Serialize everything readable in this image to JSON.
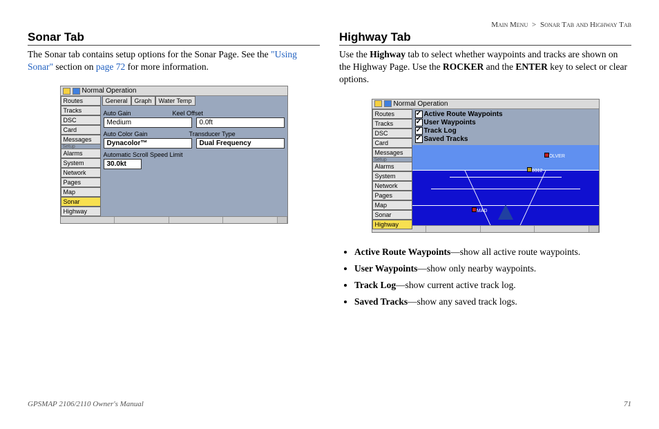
{
  "breadcrumb": {
    "root": "Main Menu",
    "sep": ">",
    "leaf": "Sonar Tab and Highway Tab"
  },
  "sonar": {
    "heading": "Sonar Tab",
    "intro_a": "The Sonar tab contains setup options for the Sonar Page. See the ",
    "intro_link": "\"Using Sonar\"",
    "intro_b": " section on ",
    "intro_page": "page 72",
    "intro_c": " for more information.",
    "app_title": "Normal Operation",
    "tabs": [
      "Routes",
      "Tracks",
      "DSC",
      "Card",
      "Messages"
    ],
    "spacer": "Setup",
    "tabs2": [
      "Alarms",
      "System",
      "Network",
      "Pages",
      "Map",
      "Sonar",
      "Highway"
    ],
    "tabs2_selected": "Sonar",
    "subtabs": [
      "General",
      "Graph",
      "Water Temp"
    ],
    "lbl_autogain": "Auto Gain",
    "lbl_keel": "Keel Offset",
    "val_autogain": "Medium",
    "val_keel": "0.0ft",
    "lbl_color": "Auto Color Gain",
    "lbl_trans": "Transducer Type",
    "val_color": "Dynacolor™",
    "val_trans": "Dual Frequency",
    "lbl_speed": "Automatic Scroll Speed Limit",
    "val_speed": "30.0kt"
  },
  "highway": {
    "heading": "Highway Tab",
    "intro_a": "Use the ",
    "intro_b": "Highway",
    "intro_c": " tab to select whether waypoints and tracks are shown on the Highway Page. Use the ",
    "intro_d": "ROCKER",
    "intro_e": " and the ",
    "intro_f": "ENTER",
    "intro_g": " key to select or clear options.",
    "app_title": "Normal Operation",
    "tabs": [
      "Routes",
      "Tracks",
      "DSC",
      "Card",
      "Messages"
    ],
    "spacer": "Setup",
    "tabs2": [
      "Alarms",
      "System",
      "Network",
      "Pages",
      "Map",
      "Sonar",
      "Highway"
    ],
    "tabs2_selected": "Highway",
    "checks": [
      "Active Route Waypoints",
      "User Waypoints",
      "Track Log",
      "Saved Tracks"
    ],
    "wp_labels": [
      "OLVER",
      "0312",
      "MAD"
    ],
    "bullets": [
      {
        "term": "Active Route Waypoints",
        "desc": "—show all active route waypoints."
      },
      {
        "term": "User Waypoints",
        "desc": "—show only nearby waypoints."
      },
      {
        "term": "Track Log",
        "desc": "—show current active track log."
      },
      {
        "term": "Saved Tracks",
        "desc": "—show any saved track logs."
      }
    ]
  },
  "footer": {
    "left": "GPSMAP 2106/2110 Owner's Manual",
    "page": "71"
  }
}
